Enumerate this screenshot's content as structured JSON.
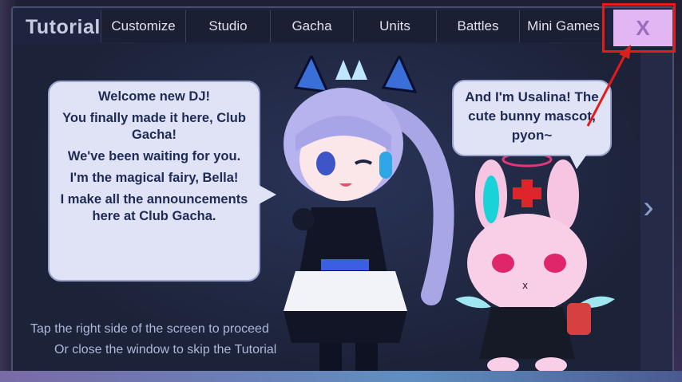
{
  "header": {
    "title": "Tutorial",
    "tabs": [
      {
        "label": "Customize"
      },
      {
        "label": "Studio"
      },
      {
        "label": "Gacha"
      },
      {
        "label": "Units"
      },
      {
        "label": "Battles"
      },
      {
        "label": "Mini Games"
      }
    ],
    "close_label": "X"
  },
  "dialog": {
    "bella_lines": [
      "Welcome new DJ!",
      "You finally made it here, Club Gacha!",
      "We've been waiting for you.",
      "I'm the magical fairy, Bella!",
      "I make all the announcements here at Club Gacha."
    ],
    "usalina_line": "And I'm Usalina! The cute bunny mascot, pyon~"
  },
  "footer": {
    "hint_proceed": "Tap the right side of the screen to proceed",
    "hint_skip": "Or close the window to skip the Tutorial"
  },
  "icons": {
    "next": "chevron-right-icon",
    "close": "close-icon"
  },
  "colors": {
    "highlight_outline": "#e31b1b",
    "close_button_bg": "#e2b6f3",
    "bubble_bg": "#dfe3f5"
  }
}
